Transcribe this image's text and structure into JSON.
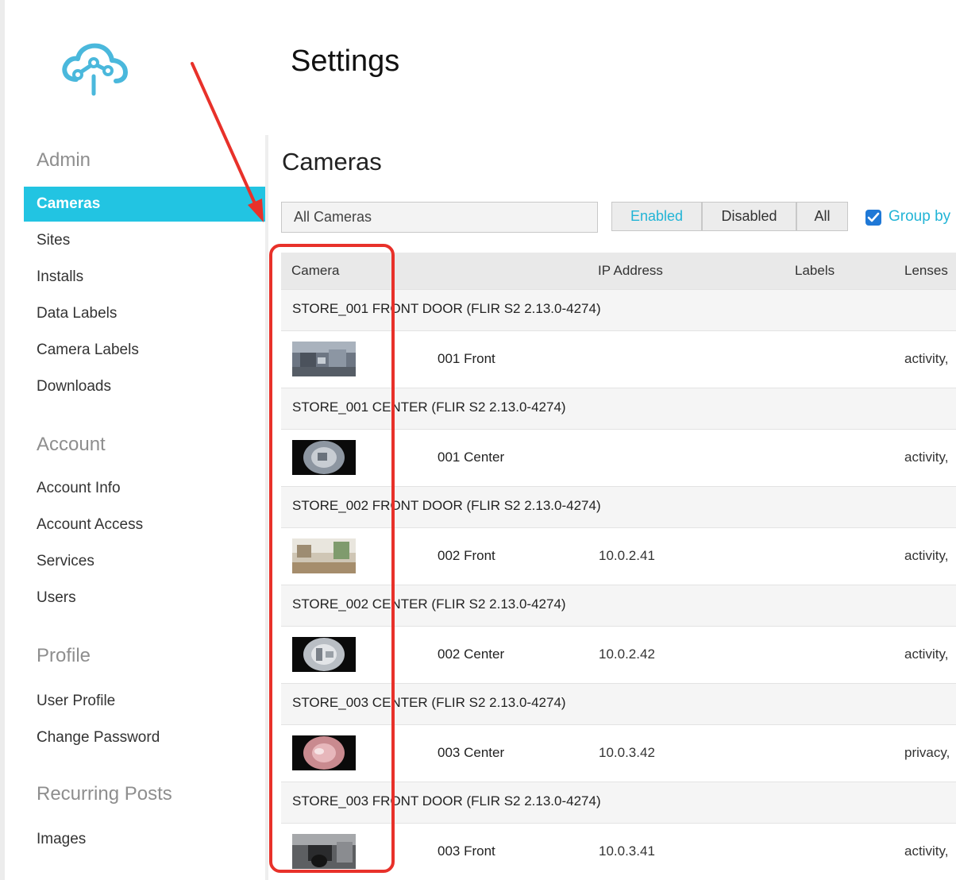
{
  "app": {
    "page_title": "Settings",
    "logo_icon": "cloud-network-icon",
    "brand_color": "#22c4e2"
  },
  "sidebar": {
    "sections": [
      {
        "heading": "Admin",
        "items": [
          {
            "label": "Cameras",
            "active": true
          },
          {
            "label": "Sites"
          },
          {
            "label": "Installs"
          },
          {
            "label": "Data Labels"
          },
          {
            "label": "Camera Labels"
          },
          {
            "label": "Downloads"
          }
        ]
      },
      {
        "heading": "Account",
        "items": [
          {
            "label": "Account Info"
          },
          {
            "label": "Account Access"
          },
          {
            "label": "Services"
          },
          {
            "label": "Users"
          }
        ]
      },
      {
        "heading": "Profile",
        "items": [
          {
            "label": "User Profile"
          },
          {
            "label": "Change Password"
          }
        ]
      },
      {
        "heading": "Recurring Posts",
        "items": [
          {
            "label": "Images"
          }
        ]
      }
    ]
  },
  "main": {
    "title": "Cameras",
    "filter": {
      "value": "All Cameras"
    },
    "status_filter": {
      "options": [
        "Enabled",
        "Disabled",
        "All"
      ],
      "selected": "Enabled"
    },
    "group_by": {
      "label": "Group by",
      "checked": true
    },
    "table": {
      "columns": [
        "Camera",
        "IP Address",
        "Labels",
        "Lenses"
      ],
      "groups": [
        {
          "title": "STORE_001 FRONT DOOR (FLIR S2 2.13.0-4274)",
          "camera": {
            "name": "001 Front",
            "ip": "",
            "lenses": "activity,",
            "thumb": "indoor-wide"
          }
        },
        {
          "title": "STORE_001 CENTER (FLIR S2 2.13.0-4274)",
          "camera": {
            "name": "001 Center",
            "ip": "",
            "lenses": "activity,",
            "thumb": "fisheye-dark"
          }
        },
        {
          "title": "STORE_002 FRONT DOOR (FLIR S2 2.13.0-4274)",
          "camera": {
            "name": "002 Front",
            "ip": "10.0.2.41",
            "lenses": "activity,",
            "thumb": "indoor-bright"
          }
        },
        {
          "title": "STORE_002 CENTER (FLIR S2 2.13.0-4274)",
          "camera": {
            "name": "002 Center",
            "ip": "10.0.2.42",
            "lenses": "activity,",
            "thumb": "fisheye-light"
          }
        },
        {
          "title": "STORE_003 CENTER (FLIR S2 2.13.0-4274)",
          "camera": {
            "name": "003 Center",
            "ip": "10.0.3.42",
            "lenses": "privacy,",
            "thumb": "fisheye-pink"
          }
        },
        {
          "title": "STORE_003 FRONT DOOR (FLIR S2 2.13.0-4274)",
          "camera": {
            "name": "003 Front",
            "ip": "10.0.3.41",
            "lenses": "activity,",
            "thumb": "indoor-dark"
          }
        }
      ]
    }
  },
  "annotation": {
    "color": "#e8312a"
  }
}
